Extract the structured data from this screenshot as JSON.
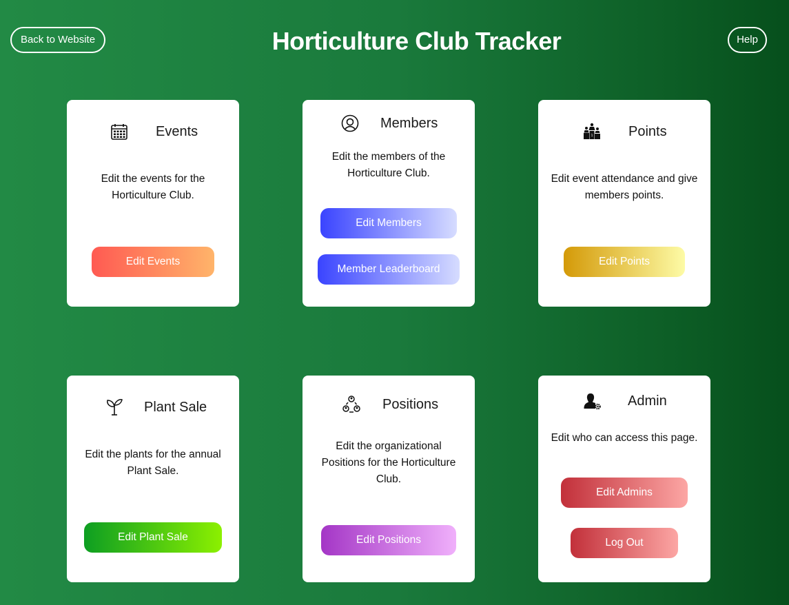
{
  "header": {
    "back_label": "Back to Website",
    "title": "Horticulture Club Tracker",
    "help_label": "Help"
  },
  "cards": {
    "events": {
      "icon": "calendar-icon",
      "title": "Events",
      "description": "Edit the events for the Horticulture Club.",
      "buttons": [
        "Edit Events"
      ]
    },
    "members": {
      "icon": "member-icon",
      "title": "Members",
      "description": "Edit the members of the Horticulture Club.",
      "buttons": [
        "Edit Members",
        "Member Leaderboard"
      ]
    },
    "points": {
      "icon": "podium-icon",
      "title": "Points",
      "description": "Edit event attendance and give members points.",
      "buttons": [
        "Edit Points"
      ]
    },
    "plant_sale": {
      "icon": "plant-icon",
      "title": "Plant Sale",
      "description": "Edit the plants for the annual Plant Sale.",
      "buttons": [
        "Edit Plant Sale"
      ]
    },
    "positions": {
      "icon": "org-icon",
      "title": "Positions",
      "description": "Edit the organizational Positions for the Horticulture Club.",
      "buttons": [
        "Edit Positions"
      ]
    },
    "admin": {
      "icon": "admin-gear-icon",
      "title": "Admin",
      "description": "Edit who can access this page.",
      "buttons": [
        "Edit Admins",
        "Log Out"
      ]
    }
  },
  "colors": {
    "background_start": "#228a45",
    "background_end": "#064f1c",
    "events_button": [
      "#ff5a52",
      "#ffb46a"
    ],
    "members_button": [
      "#3a44ff",
      "#d6dcff"
    ],
    "points_button": [
      "#d49a08",
      "#fdfba6"
    ],
    "plant_sale_button": [
      "#0d9e22",
      "#8cf000"
    ],
    "positions_button": [
      "#a436c6",
      "#f0b0fb"
    ],
    "admin_button": [
      "#c2303a",
      "#fca6a4"
    ]
  }
}
